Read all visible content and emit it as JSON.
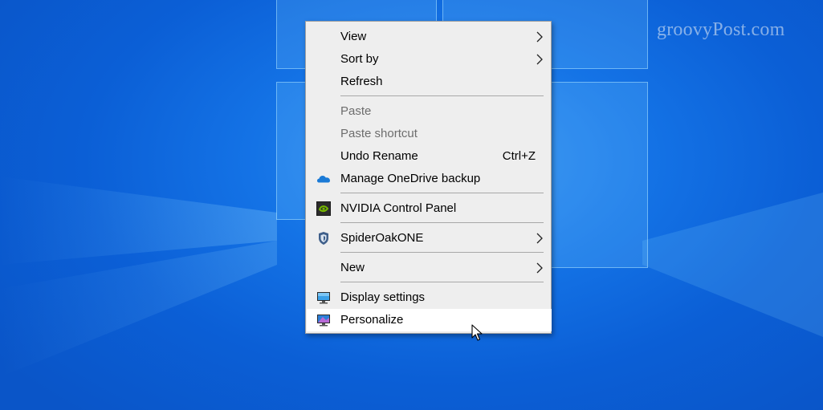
{
  "watermark": "groovyPost.com",
  "menu": {
    "items": [
      {
        "label": "View",
        "submenu": true
      },
      {
        "label": "Sort by",
        "submenu": true
      },
      {
        "label": "Refresh"
      },
      {
        "label": "Paste",
        "disabled": true
      },
      {
        "label": "Paste shortcut",
        "disabled": true
      },
      {
        "label": "Undo Rename",
        "shortcut": "Ctrl+Z"
      },
      {
        "label": "Manage OneDrive backup",
        "icon": "onedrive-cloud-icon"
      },
      {
        "label": "NVIDIA Control Panel",
        "icon": "nvidia-icon"
      },
      {
        "label": "SpiderOakONE",
        "icon": "spideroak-shield-icon",
        "submenu": true
      },
      {
        "label": "New",
        "submenu": true
      },
      {
        "label": "Display settings",
        "icon": "display-monitor-icon"
      },
      {
        "label": "Personalize",
        "icon": "personalize-monitor-icon",
        "highlighted": true
      }
    ]
  },
  "colors": {
    "desktop": "#0b5fd6",
    "menu_bg": "#eeeeee",
    "highlight": "#ffffff",
    "disabled_text": "#6d6d6d"
  }
}
